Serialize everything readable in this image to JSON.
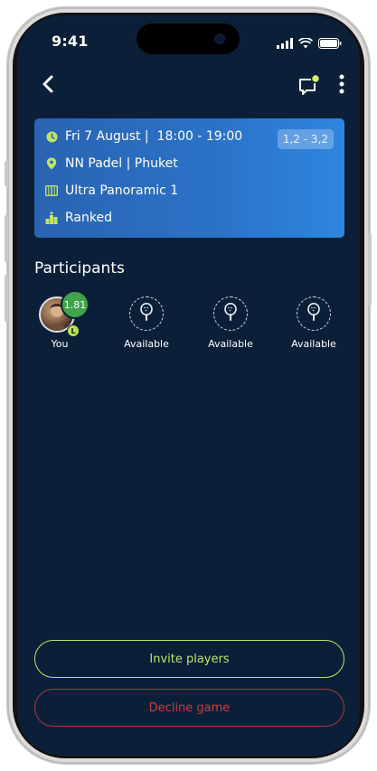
{
  "status_bar": {
    "time": "9:41"
  },
  "topbar": {
    "back_icon": "chevron-left-icon",
    "chat_icon": "chat-bubble-icon",
    "more_icon": "more-vertical-icon"
  },
  "match": {
    "datetime": "Fri 7 August |  18:00 - 19:00",
    "venue": "NN Padel | Phuket",
    "court": "Ultra Panoramic 1",
    "type": "Ranked",
    "level_range": "1,2 - 3,2"
  },
  "participants": {
    "title": "Participants",
    "you": {
      "rating": "1.81",
      "level_badge": "L",
      "label": "You"
    },
    "open_slots": [
      {
        "label": "Available"
      },
      {
        "label": "Available"
      },
      {
        "label": "Available"
      }
    ]
  },
  "actions": {
    "invite_label": "Invite players",
    "decline_label": "Decline game"
  },
  "colors": {
    "background": "#0b2038",
    "accent_green": "#bfe36a",
    "decline_red": "#cf3a43",
    "card_blue": "#2b73c8"
  }
}
